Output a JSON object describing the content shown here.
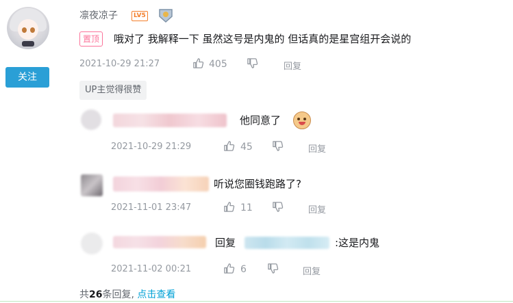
{
  "comment": {
    "username": "凛夜凉子",
    "level_badge": "LV5",
    "pinned_label": "置顶",
    "text": "哦对了 我解释一下 虽然这号是内鬼的 但话真的是星宫组开会说的",
    "time": "2021-10-29 21:27",
    "likes": "405",
    "reply_label": "回复",
    "follow_label": "关注",
    "up_badge": "UP主觉得很赞"
  },
  "replies": [
    {
      "text": "他同意了",
      "time": "2021-10-29 21:29",
      "likes": "45",
      "reply_label": "回复"
    },
    {
      "text": "听说您圈钱跑路了?",
      "time": "2021-11-01 23:47",
      "likes": "11",
      "reply_label": "回复"
    },
    {
      "prefix": "回复",
      "text": ":这是内鬼",
      "time": "2021-11-02 00:21",
      "likes": "6",
      "reply_label": "回复"
    }
  ],
  "footer": {
    "prefix": "共",
    "count": "26",
    "suffix": "条回复,",
    "link": "点击查看"
  }
}
